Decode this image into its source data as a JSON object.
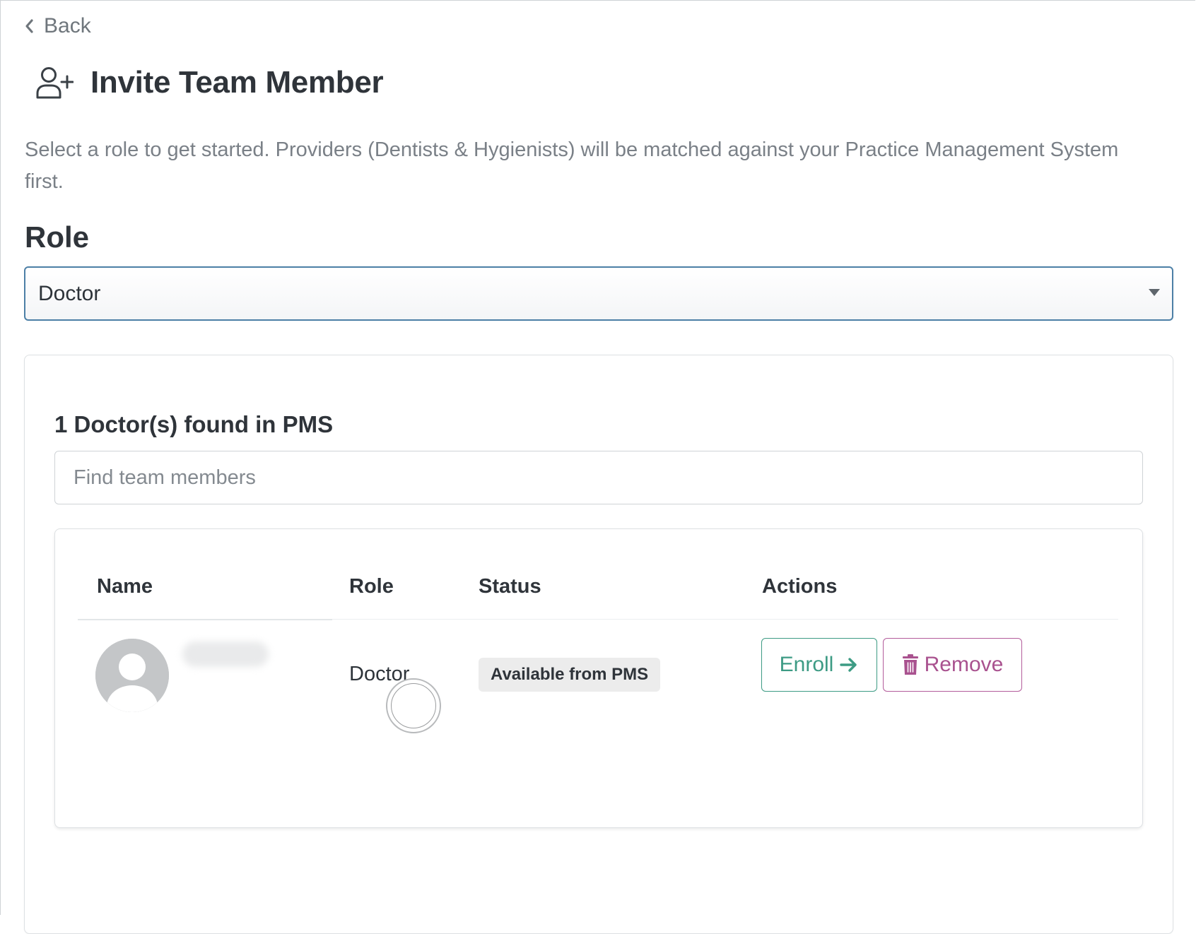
{
  "nav": {
    "back_label": "Back"
  },
  "header": {
    "title": "Invite Team Member",
    "icon": "user-plus-icon"
  },
  "intro": {
    "text": "Select a role to get started. Providers (Dentists & Hygienists) will be matched against your Practice Management System first."
  },
  "role_field": {
    "label": "Role",
    "selected_value": "Doctor"
  },
  "results": {
    "heading": "1 Doctor(s) found in PMS",
    "search_placeholder": "Find team members",
    "columns": {
      "name": "Name",
      "role": "Role",
      "status": "Status",
      "actions": "Actions"
    },
    "rows": [
      {
        "role": "Doctor",
        "status": "Available from PMS",
        "enroll_label": "Enroll",
        "remove_label": "Remove"
      }
    ]
  },
  "colors": {
    "select_border": "#4c7fa6",
    "enroll_accent": "#3d9b84",
    "remove_accent": "#a9528f",
    "muted_text": "#7a8087",
    "badge_bg": "#ececec"
  }
}
